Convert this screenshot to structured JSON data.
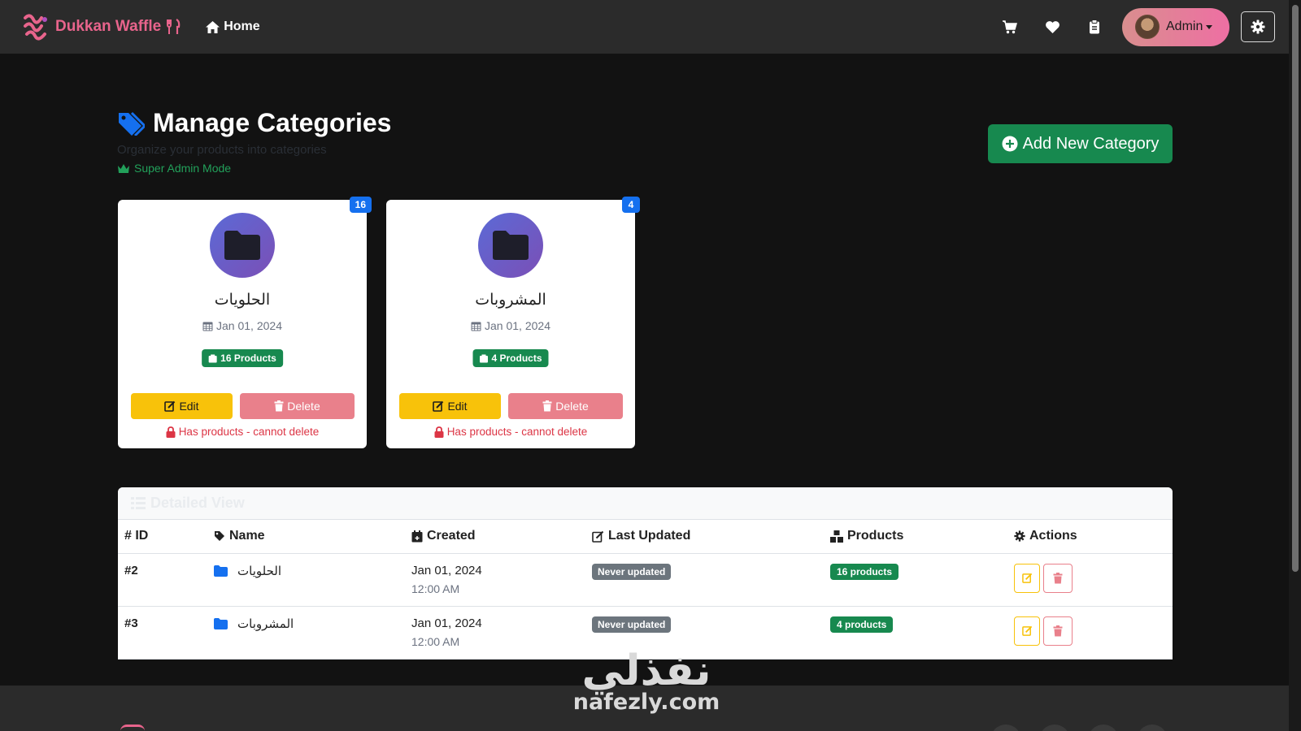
{
  "navbar": {
    "brand_name": "Dukkan Waffle",
    "home_label": "Home",
    "admin_label": "Admin",
    "icons": [
      "cart-icon",
      "heart-icon",
      "clipboard-icon",
      "gear-icon"
    ]
  },
  "header": {
    "title": "Manage Categories",
    "subtitle": "Organize your products into categories",
    "mode_label": "Super Admin Mode",
    "add_button_label": "Add New Category"
  },
  "cards": [
    {
      "count": "16",
      "name": "الحلويات",
      "date": "Jan 01, 2024",
      "products_label": "16 Products",
      "edit_label": "Edit",
      "delete_label": "Delete",
      "lock_text": "Has products - cannot delete"
    },
    {
      "count": "4",
      "name": "المشروبات",
      "date": "Jan 01, 2024",
      "products_label": "4 Products",
      "edit_label": "Edit",
      "delete_label": "Delete",
      "lock_text": "Has products - cannot delete"
    }
  ],
  "table": {
    "heading": "Detailed View",
    "columns": [
      "# ID",
      "Name",
      "Created",
      "Last Updated",
      "Products",
      "Actions"
    ],
    "rows": [
      {
        "id": "#2",
        "name": "الحلويات",
        "created_date": "Jan 01, 2024",
        "created_time": "12:00 AM",
        "last_updated": "Never updated",
        "products": "16 products"
      },
      {
        "id": "#3",
        "name": "المشروبات",
        "created_date": "Jan 01, 2024",
        "created_time": "12:00 AM",
        "last_updated": "Never updated",
        "products": "4 products"
      }
    ]
  },
  "watermark": {
    "arabic": "نفذلي",
    "latin": "nafezly.com"
  },
  "colors": {
    "brand_pink": "#e8648c",
    "accent_green": "#17894f",
    "badge_blue": "#1570ef",
    "edit_yellow": "#f8c20a",
    "delete_red": "#e9808b"
  }
}
